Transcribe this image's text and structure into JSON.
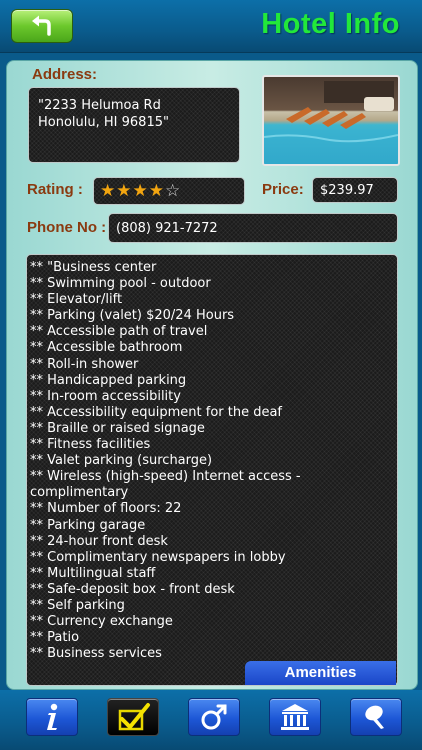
{
  "header": {
    "title": "Hotel Info",
    "back_icon": "back-arrow-icon"
  },
  "address": {
    "label": "Address:",
    "value": "\"2233 Helumoa Rd\nHonolulu, HI 96815\""
  },
  "rating": {
    "label": "Rating :",
    "stars_filled": 4,
    "stars_total": 5
  },
  "price": {
    "label": "Price:",
    "value": "$239.97"
  },
  "phone": {
    "label": "Phone No :",
    "value": "(808) 921-7272"
  },
  "amenities": {
    "tab_label": "Amenities",
    "items": [
      "** \"Business center",
      "** Swimming pool - outdoor",
      "** Elevator/lift",
      "** Parking (valet) $20/24 Hours",
      "** Accessible path of travel",
      "** Accessible bathroom",
      "** Roll-in shower",
      "** Handicapped parking",
      "** In-room accessibility",
      "** Accessibility equipment for the deaf",
      "** Braille or raised signage",
      "** Fitness facilities",
      "** Valet parking (surcharge)",
      "** Wireless (high-speed) Internet access -",
      "complimentary",
      "** Number of floors: 22",
      "** Parking garage",
      "** 24-hour front desk",
      "** Complimentary newspapers in lobby",
      "** Multilingual staff",
      "** Safe-deposit box - front desk",
      "** Self parking",
      "** Currency exchange",
      "** Patio",
      "** Business services"
    ]
  },
  "toolbar": {
    "buttons": [
      {
        "icon": "info-icon"
      },
      {
        "icon": "checkmark-icon",
        "selected": true
      },
      {
        "icon": "male-symbol-icon"
      },
      {
        "icon": "bank-building-icon"
      },
      {
        "icon": "map-pin-icon"
      }
    ]
  },
  "colors": {
    "title_green": "#22e83a",
    "label_brown": "#8a3a10",
    "star_gold": "#f2a510",
    "bar_blue": "#0a5b8c",
    "button_blue": "#1d57d6"
  }
}
